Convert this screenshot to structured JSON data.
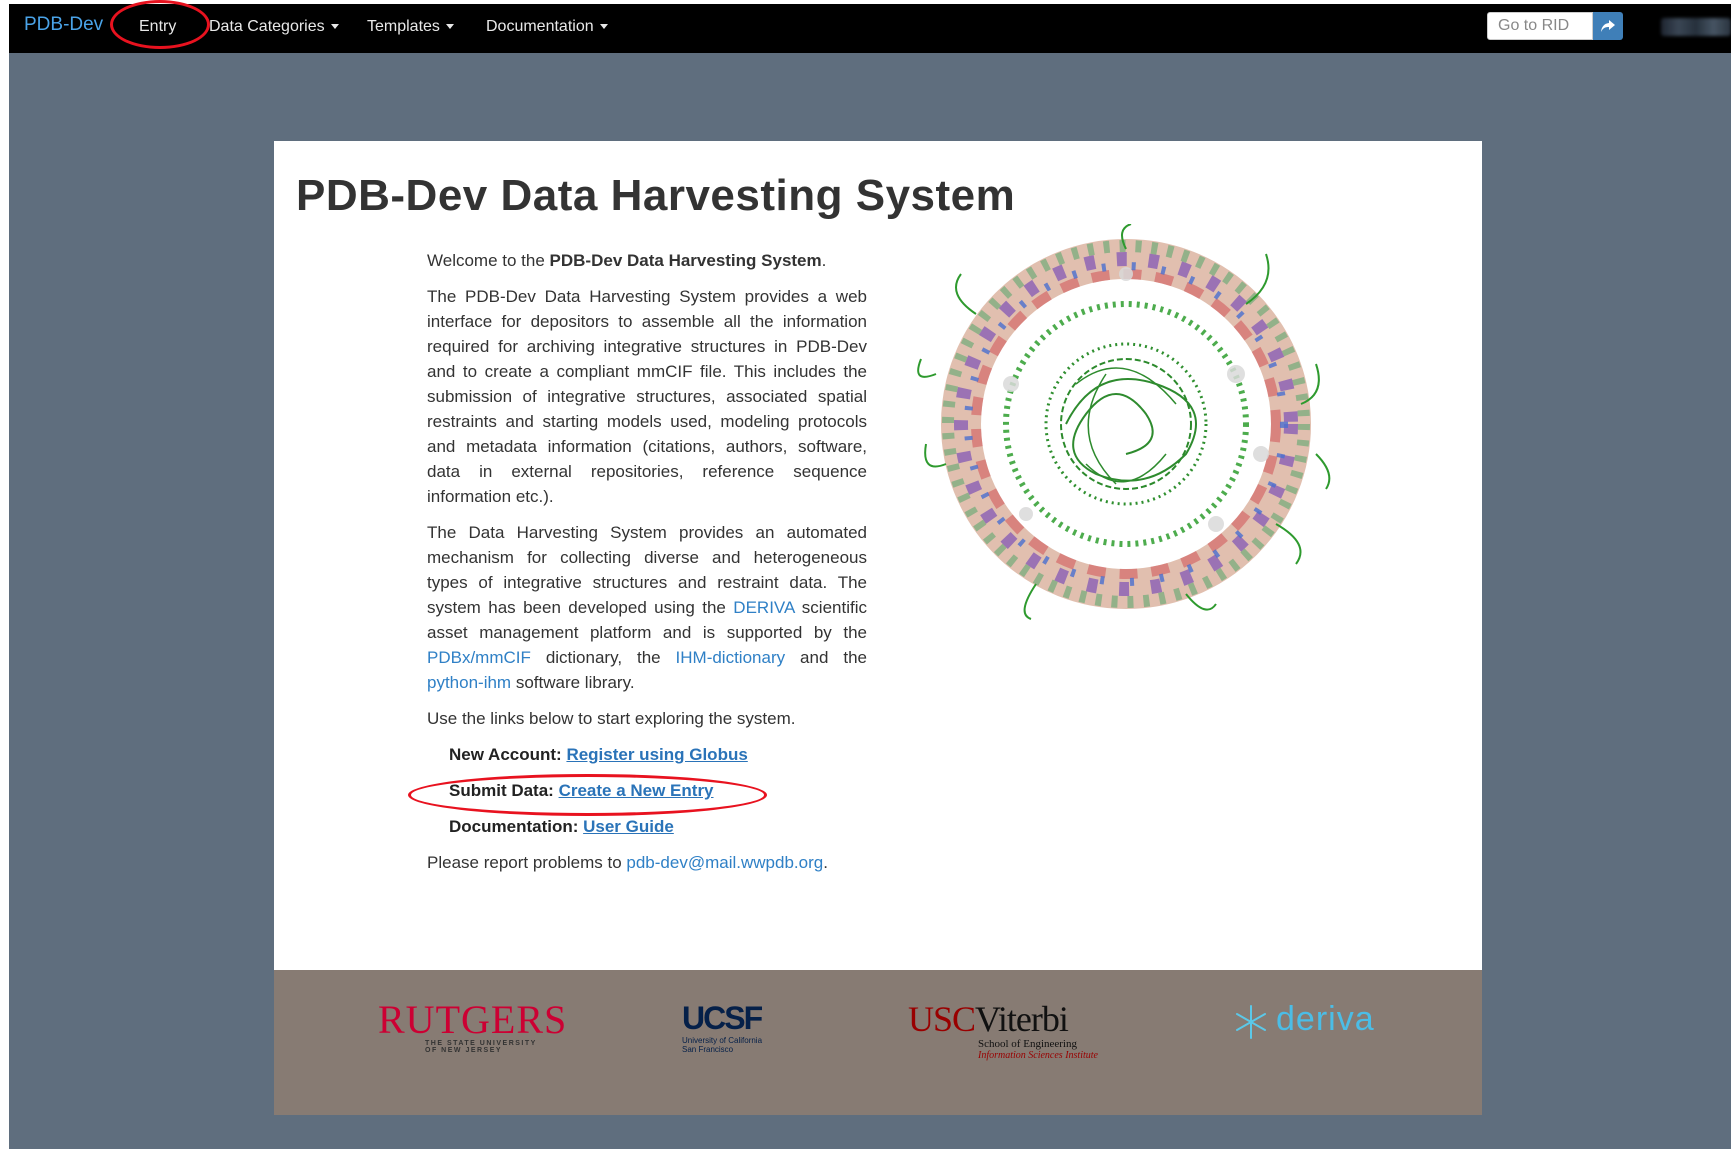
{
  "nav": {
    "brand": "PDB-Dev",
    "items": [
      {
        "label": "Entry",
        "dropdown": false
      },
      {
        "label": "Data Categories",
        "dropdown": true
      },
      {
        "label": "Templates",
        "dropdown": true
      },
      {
        "label": "Documentation",
        "dropdown": true
      }
    ],
    "rid_placeholder": "Go to RID",
    "rid_button_icon": "share-arrow-icon"
  },
  "main": {
    "title": "PDB-Dev Data Harvesting System",
    "welcome": {
      "prefix": "Welcome to the ",
      "bold": "PDB-Dev Data Harvesting System",
      "suffix": "."
    },
    "para1": "The PDB-Dev Data Harvesting System provides a web interface for depositors to assemble all the information required for archiving integrative structures in PDB-Dev and to create a compliant mmCIF file. This includes the submission of integrative structures, associated spatial restraints and starting models used, modeling protocols and metadata information (citations, authors, software, data in external repositories, reference sequence information etc.).",
    "para2": {
      "t1": "The Data Harvesting System provides an automated mechanism for collecting diverse and heterogeneous types of integrative structures and restraint data. The system has been developed using the ",
      "link1": "DERIVA",
      "t2": " scientific asset management platform and is supported by the ",
      "link2": "PDBx/mmCIF",
      "t3": " dictionary, the ",
      "link3": "IHM-dictionary",
      "t4": " and the ",
      "link4": "python-ihm",
      "t5": " software library."
    },
    "para3": "Use the links below to start exploring the system.",
    "links": [
      {
        "label": "New Account: ",
        "link": "Register using Globus"
      },
      {
        "label": "Submit Data: ",
        "link": "Create a New Entry"
      },
      {
        "label": "Documentation: ",
        "link": "User Guide"
      }
    ],
    "report": {
      "prefix": "Please report problems to ",
      "email": "pdb-dev@mail.wwpdb.org",
      "suffix": "."
    }
  },
  "footer": {
    "logos": {
      "rutgers": {
        "name": "RUTGERS",
        "sub1": "THE STATE UNIVERSITY",
        "sub2": "OF NEW JERSEY"
      },
      "ucsf": {
        "name": "UCSF",
        "sub1": "University of California",
        "sub2": "San Francisco"
      },
      "usc": {
        "name1": "USC",
        "name2": "Viterbi",
        "sub1": "School of Engineering",
        "sub2": "Information Sciences Institute"
      },
      "deriva": {
        "name": "deriva"
      }
    }
  },
  "colors": {
    "navbar": "#000000",
    "page_bg": "#5f6e7e",
    "brand": "#4aa3e8",
    "link": "#2f80c6",
    "footer": "#877b73",
    "annotation": "#e8121f"
  }
}
